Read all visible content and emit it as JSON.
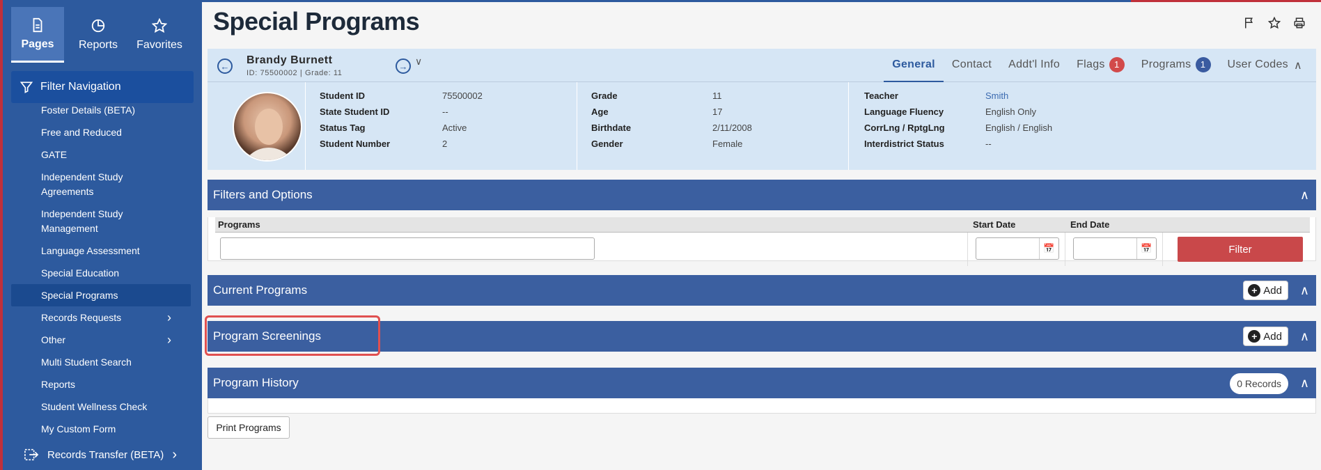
{
  "sidebar": {
    "tabs": [
      {
        "label": "Pages",
        "icon": "document-icon"
      },
      {
        "label": "Reports",
        "icon": "pie-chart-icon"
      },
      {
        "label": "Favorites",
        "icon": "star-icon"
      }
    ],
    "filter_label": "Filter Navigation",
    "items": [
      "Foster Details (BETA)",
      "Free and Reduced",
      "GATE",
      "Independent Study Agreements",
      "Independent Study Management",
      "Language Assessment",
      "Special Education",
      "Special Programs",
      "Records Requests",
      "Other",
      "Multi Student Search",
      "Reports",
      "Student Wellness Check",
      "My Custom Form"
    ],
    "bottom_item": "Records Transfer (BETA)"
  },
  "page": {
    "title": "Special Programs"
  },
  "student": {
    "name": "Brandy Burnett",
    "sub": "ID: 75500002 |  Grade: 11"
  },
  "tabs": {
    "general": "General",
    "contact": "Contact",
    "addtl": "Addt'l Info",
    "flags": "Flags",
    "flags_count": "1",
    "programs": "Programs",
    "programs_count": "1",
    "user_codes": "User Codes"
  },
  "info": {
    "col1": [
      {
        "label": "Student ID",
        "value": "75500002"
      },
      {
        "label": "State Student ID",
        "value": "--"
      },
      {
        "label": "Status Tag",
        "value": "Active"
      },
      {
        "label": "Student Number",
        "value": "2"
      }
    ],
    "col2": [
      {
        "label": "Grade",
        "value": "11"
      },
      {
        "label": "Age",
        "value": "17"
      },
      {
        "label": "Birthdate",
        "value": "2/11/2008"
      },
      {
        "label": "Gender",
        "value": "Female"
      }
    ],
    "col3": [
      {
        "label": "Teacher",
        "value": "Smith"
      },
      {
        "label": "Language Fluency",
        "value": "English Only"
      },
      {
        "label": "CorrLng / RptgLng",
        "value": "English / English"
      },
      {
        "label": "Interdistrict Status",
        "value": "--"
      }
    ]
  },
  "filters": {
    "title": "Filters and Options",
    "programs_label": "Programs",
    "start_label": "Start Date",
    "end_label": "End Date",
    "filter_button": "Filter"
  },
  "current": {
    "title": "Current Programs",
    "add": "Add"
  },
  "screenings": {
    "title": "Program Screenings",
    "add": "Add"
  },
  "history": {
    "title": "Program History",
    "records": "0 Records"
  },
  "print_button": "Print Programs"
}
